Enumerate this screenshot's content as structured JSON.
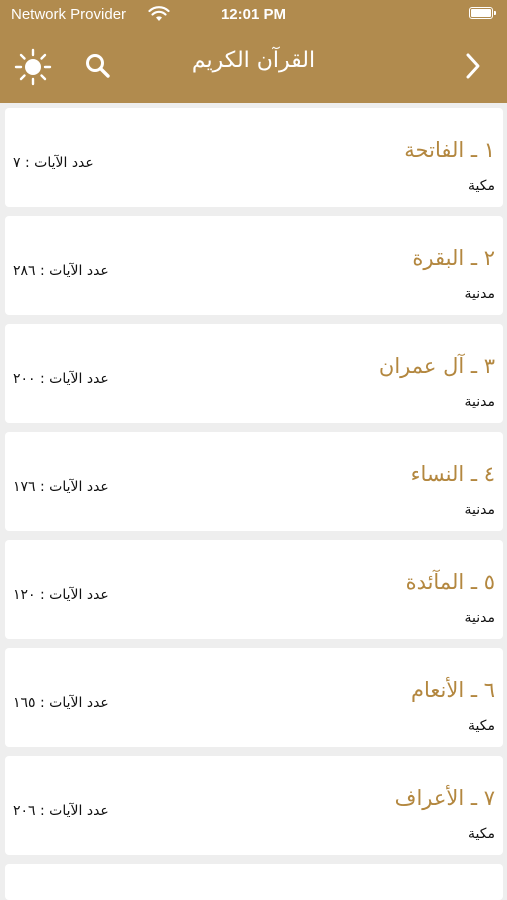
{
  "status_bar": {
    "carrier": "Network Provider",
    "time": "12:01 PM"
  },
  "header": {
    "title": "القرآن الكريم",
    "icons": [
      "sun-icon",
      "search-icon",
      "chevron-right-icon"
    ]
  },
  "colors": {
    "header_bg": "#b18b4e",
    "accent_text": "#b3873f",
    "page_bg": "#eeeeee"
  },
  "surahs": [
    {
      "name": "١ ـ الفاتحة",
      "type": "مكية",
      "ayat": "عدد الآيات : ٧"
    },
    {
      "name": "٢ ـ البقرة",
      "type": "مدنية",
      "ayat": "عدد الآيات : ٢٨٦"
    },
    {
      "name": "٣ ـ آل عمران",
      "type": "مدنية",
      "ayat": "عدد الآيات : ٢٠٠"
    },
    {
      "name": "٤ ـ النساء",
      "type": "مدنية",
      "ayat": "عدد الآيات : ١٧٦"
    },
    {
      "name": "٥ ـ المآئدة",
      "type": "مدنية",
      "ayat": "عدد الآيات : ١٢٠"
    },
    {
      "name": "٦ ـ الأنعام",
      "type": "مكية",
      "ayat": "عدد الآيات : ١٦٥"
    },
    {
      "name": "٧ ـ الأعراف",
      "type": "مكية",
      "ayat": "عدد الآيات : ٢٠٦"
    }
  ]
}
